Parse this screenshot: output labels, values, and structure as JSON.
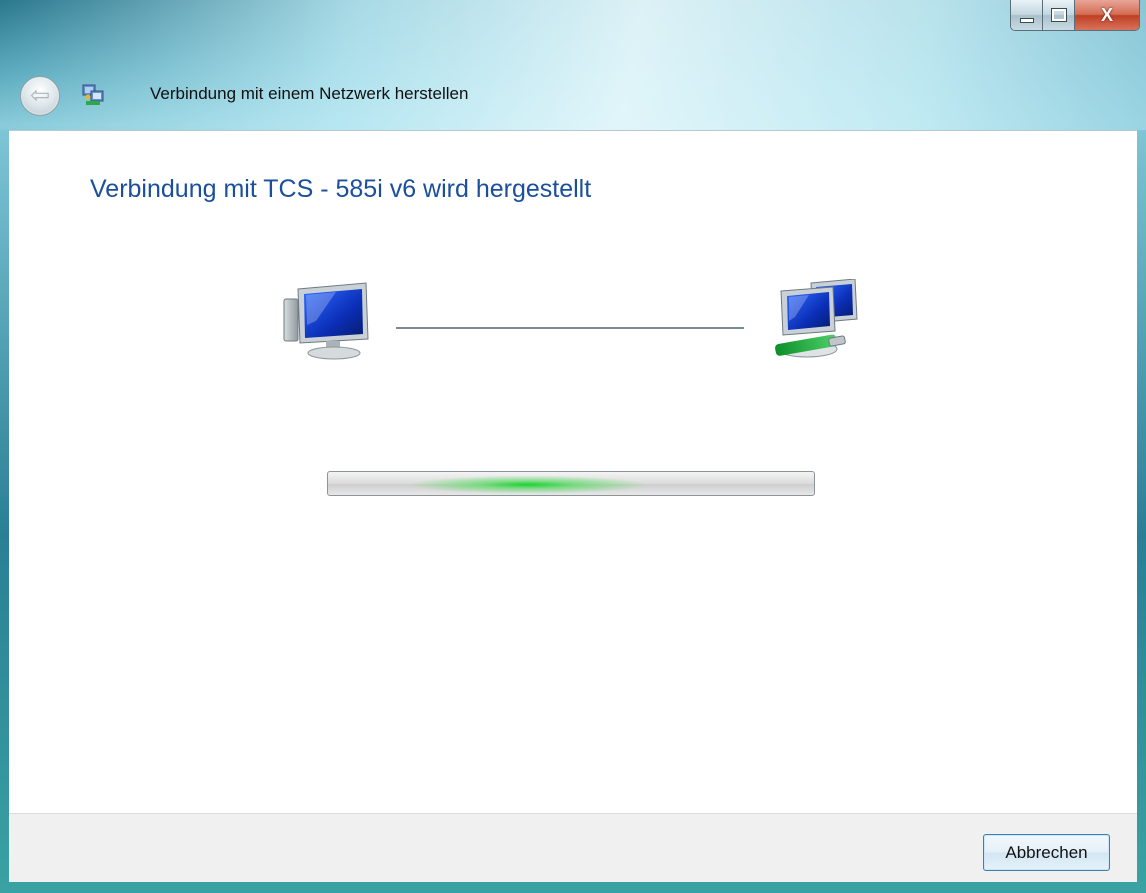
{
  "window": {
    "title": "Verbindung mit einem Netzwerk herstellen",
    "caption_buttons": {
      "minimize_icon": "minimize-icon",
      "maximize_icon": "maximize-icon",
      "close_label": "X"
    }
  },
  "nav": {
    "back_icon": "back-arrow-icon",
    "back_glyph": "⇦",
    "app_icon": "network-connect-icon"
  },
  "main": {
    "heading": "Verbindung mit TCS - 585i v6 wird hergestellt",
    "left_icon": "computer-icon",
    "right_icon": "network-icon",
    "progress": {
      "state": "indeterminate",
      "colour": "#1cd234"
    }
  },
  "footer": {
    "cancel_label": "Abbrechen"
  },
  "colors": {
    "heading": "#1b4f9c",
    "button_border": "#3c7fb1"
  }
}
